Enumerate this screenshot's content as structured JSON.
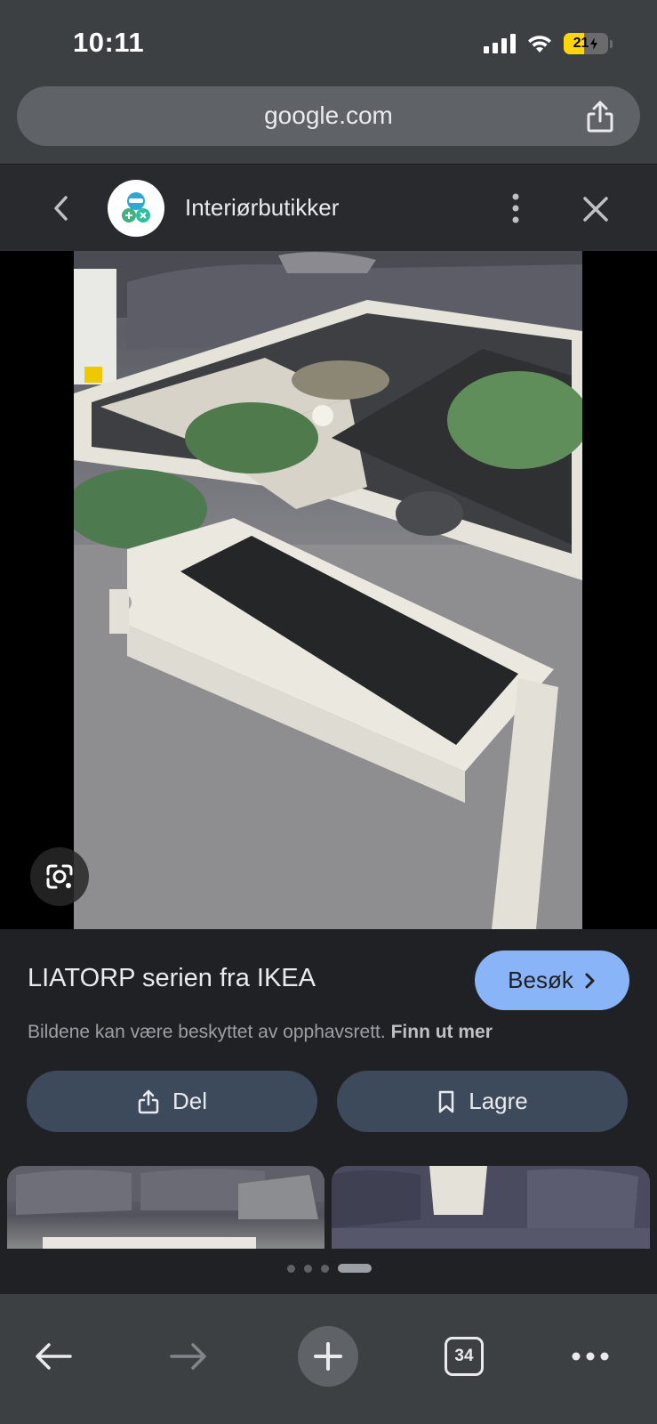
{
  "status_bar": {
    "time": "10:11",
    "battery_level": "21",
    "battery_fraction": 0.21,
    "battery_color": "#ffd60a",
    "icons": [
      "cellular-signal-icon",
      "wifi-icon",
      "battery-charging-icon"
    ]
  },
  "browser": {
    "url": "google.com",
    "share_icon": "share-icon"
  },
  "site_header": {
    "title": "Interiørbutikker",
    "icons": [
      "chevron-left-icon",
      "site-logo",
      "more-vertical-icon",
      "close-icon"
    ]
  },
  "image": {
    "lens_icon": "google-lens-icon"
  },
  "result": {
    "title": "LIATORP serien fra IKEA",
    "visit_label": "Besøk",
    "copyright_text": "Bildene kan være beskyttet av opphavsrett.",
    "learn_more": "Finn ut mer",
    "share_label": "Del",
    "save_label": "Lagre",
    "accent_color": "#8ab4f8"
  },
  "pager": {
    "count": 4,
    "active_index": 3
  },
  "toolbar": {
    "tab_count": "34",
    "icons": [
      "arrow-back-icon",
      "arrow-forward-icon",
      "plus-icon",
      "tab-switcher-icon",
      "more-horizontal-icon"
    ]
  }
}
